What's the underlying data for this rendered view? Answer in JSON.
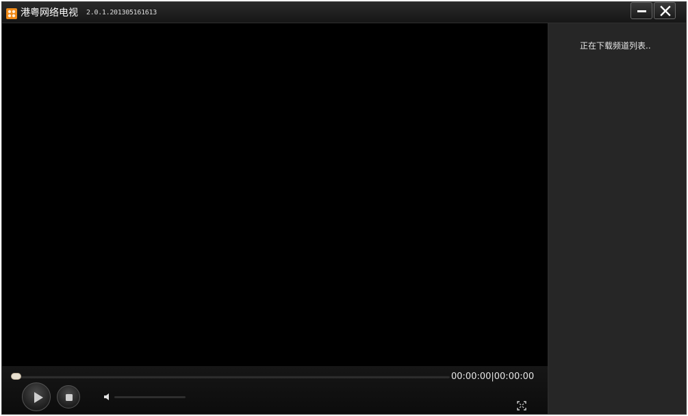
{
  "window": {
    "title": "港粤网络电视",
    "version": "2.0.1.201305161613"
  },
  "sidebar": {
    "status_text": "正在下载频道列表.."
  },
  "player": {
    "time_display": "00:00:00|00:00:00",
    "progress": 0,
    "volume": 0
  },
  "icons": {
    "app": "app-logo-icon",
    "minimize": "minimize-icon",
    "close": "close-icon",
    "play": "play-icon",
    "stop": "stop-icon",
    "volume": "speaker-icon",
    "fullscreen": "fullscreen-icon"
  },
  "colors": {
    "accent": "#f08a18",
    "background": "#000000",
    "sidebar": "#262626"
  }
}
